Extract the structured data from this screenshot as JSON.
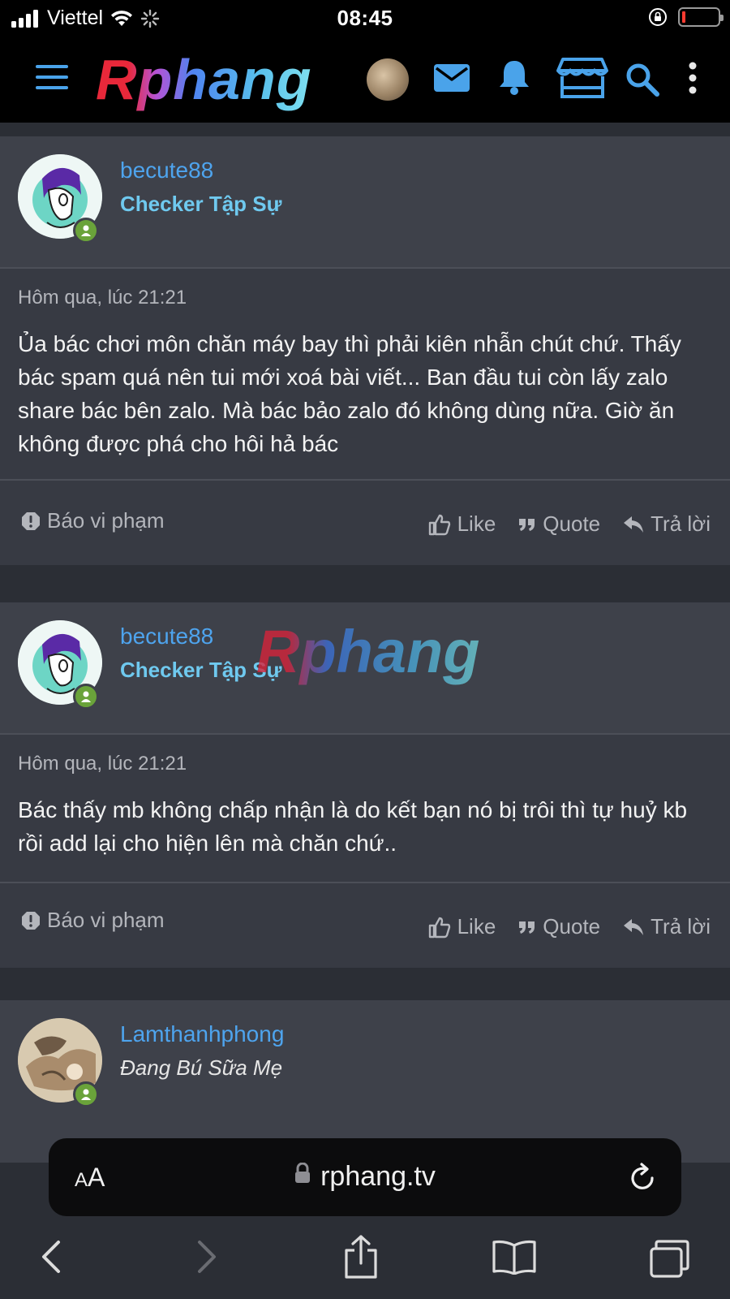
{
  "status_bar": {
    "carrier": "Viettel",
    "time": "08:45"
  },
  "header": {
    "logo_text": "Rphang",
    "icons": [
      "menu-icon",
      "user-avatar",
      "mail-icon",
      "bell-icon",
      "store-icon",
      "search-icon",
      "more-icon"
    ]
  },
  "posts": [
    {
      "username": "becute88",
      "user_title": "Checker Tập Sự",
      "timestamp": "Hôm qua, lúc 21:21",
      "content": "Ủa bác chơi môn chăn máy bay thì phải kiên nhẫn chút chứ. Thấy bác spam quá nên tui mới xoá bài viết... Ban đầu tui còn lấy zalo share bác bên zalo. Mà bác bảo zalo đó không dùng nữa. Giờ ăn không được phá cho hôi hả bác",
      "report_label": "Báo vi phạm",
      "like_label": "Like",
      "quote_label": "Quote",
      "reply_label": "Trả lời"
    },
    {
      "username": "becute88",
      "user_title": "Checker Tập Sự",
      "timestamp": "Hôm qua, lúc 21:21",
      "content": "Bác thấy mb không chấp nhận là do kết bạn nó bị trôi thì tự huỷ kb rồi add lại cho hiện lên mà chăn chứ..",
      "report_label": "Báo vi phạm",
      "like_label": "Like",
      "quote_label": "Quote",
      "reply_label": "Trả lời",
      "watermark": "Rphang"
    },
    {
      "username": "Lamthanhphong",
      "user_title": "Đang Bú Sữa Mẹ"
    }
  ],
  "browser": {
    "text_size_small": "A",
    "text_size_large": "A",
    "url": "rphang.tv"
  },
  "colors": {
    "link": "#4ea4ee",
    "user_title": "#6fc9ef",
    "online": "#6aa33a",
    "header_bg": "#000000",
    "post_bg": "#373a43"
  }
}
